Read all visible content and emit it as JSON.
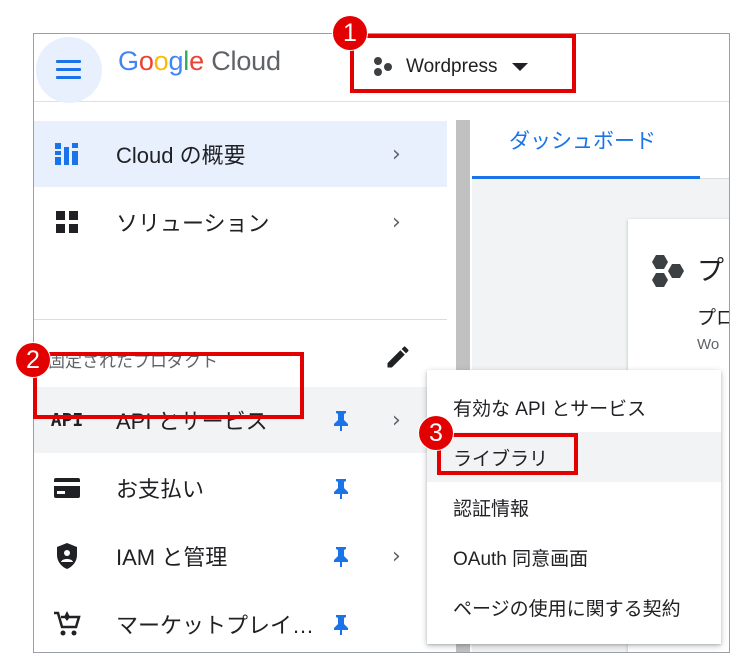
{
  "header": {
    "logo_google": "Google",
    "logo_cloud": "Cloud",
    "project_name": "Wordpress"
  },
  "sidebar": {
    "section_label": "固定されたプロダクト",
    "items": [
      {
        "label": "Cloud の概要",
        "icon": "dashboard-icon"
      },
      {
        "label": "ソリューション",
        "icon": "grid-icon"
      },
      {
        "label": "API とサービス",
        "icon": "api-icon",
        "icon_text": "API"
      },
      {
        "label": "お支払い",
        "icon": "billing-card-icon"
      },
      {
        "label": "IAM と管理",
        "icon": "shield-icon"
      },
      {
        "label": "マーケットプレイ…",
        "icon": "marketplace-cart-icon"
      }
    ]
  },
  "main": {
    "tab_label": "ダッシュボード",
    "card_title": "プ",
    "card_sub": "プロ",
    "card_sub2": "Wo"
  },
  "flyout": {
    "items": [
      {
        "label": "有効な API とサービス"
      },
      {
        "label": "ライブラリ"
      },
      {
        "label": "認証情報"
      },
      {
        "label": "OAuth 同意画面"
      },
      {
        "label": "ページの使用に関する契約"
      }
    ]
  },
  "callouts": [
    "1",
    "2",
    "3"
  ],
  "colors": {
    "accent": "#1a73e8",
    "annotation_red": "#e30000",
    "active_bg": "#e8f0fe"
  }
}
